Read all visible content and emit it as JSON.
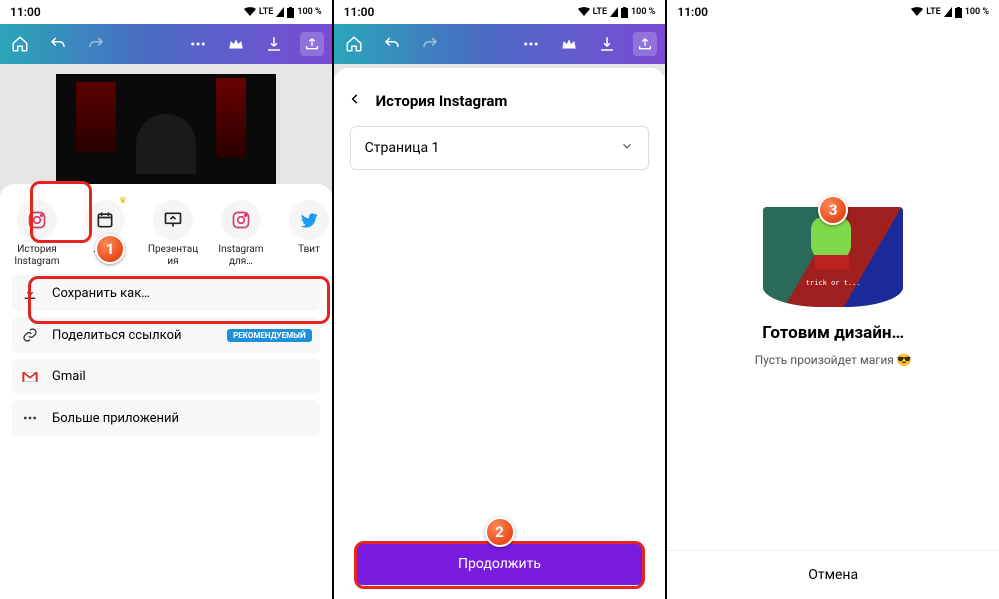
{
  "status": {
    "time": "11:00",
    "net": "LTE",
    "battery": "100 %"
  },
  "share_items": [
    {
      "label": "История\nInstagram",
      "icon": "instagram",
      "color": "#d6396f"
    },
    {
      "label": "…ров",
      "icon": "calendar",
      "color": "#222",
      "crown": true
    },
    {
      "label": "Презентац\nия",
      "icon": "present",
      "color": "#222"
    },
    {
      "label": "Instagram\nдля…",
      "icon": "instagram",
      "color": "#d6396f"
    },
    {
      "label": "Твит",
      "icon": "twitter",
      "color": "#1d9bf0"
    }
  ],
  "menu": {
    "save_as": "Сохранить как…",
    "share_link": "Поделиться ссылкой",
    "share_badge": "РЕКОМЕНДУЕМЫЙ",
    "gmail": "Gmail",
    "more": "Больше приложений"
  },
  "screen2": {
    "header": "История Instagram",
    "page_select": "Страница 1",
    "continue": "Продолжить"
  },
  "screen3": {
    "preview_text": "trick or t...",
    "title": "Готовим дизайн…",
    "subtitle": "Пусть произойдет магия 😎",
    "cancel": "Отмена"
  },
  "steps": {
    "s1": "1",
    "s2": "2",
    "s3": "3"
  }
}
